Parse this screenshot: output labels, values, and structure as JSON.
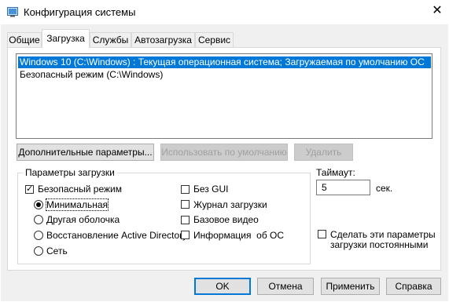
{
  "window": {
    "title": "Конфигурация системы"
  },
  "tabs": [
    {
      "label": "Общие"
    },
    {
      "label": "Загрузка"
    },
    {
      "label": "Службы"
    },
    {
      "label": "Автозагрузка"
    },
    {
      "label": "Сервис"
    }
  ],
  "os_list": [
    "Windows 10 (C:\\Windows) : Текущая операционная система; Загружаемая по умолчанию ОС",
    "Безопасный режим (C:\\Windows)"
  ],
  "buttons": {
    "advanced": "Дополнительные параметры...",
    "set_default": "Использовать по умолчанию",
    "delete": "Удалить",
    "ok": "OK",
    "cancel": "Отмена",
    "apply": "Применить",
    "help": "Справка"
  },
  "boot_options": {
    "group_label": "Параметры загрузки",
    "safe_boot": {
      "label": "Безопасный режим",
      "checked": true
    },
    "safe_modes": [
      {
        "label": "Минимальная",
        "checked": true
      },
      {
        "label": "Другая оболочка",
        "checked": false
      },
      {
        "label": "Восстановление Active Directory",
        "checked": false
      },
      {
        "label": "Сеть",
        "checked": false
      }
    ],
    "right_options": [
      {
        "label": "Без GUI",
        "checked": false
      },
      {
        "label": "Журнал загрузки",
        "checked": false
      },
      {
        "label": "Базовое видео",
        "checked": false
      },
      {
        "label": "Информация  об ОС",
        "checked": false
      }
    ]
  },
  "timeout": {
    "label": "Таймаут:",
    "value": "5",
    "unit": "сек."
  },
  "permanent": {
    "label_line1": "Сделать эти параметры",
    "label_line2": "загрузки постоянными",
    "checked": false
  },
  "colors": {
    "selection": "#0078d7",
    "dialog_bg": "#f0f0f0"
  }
}
